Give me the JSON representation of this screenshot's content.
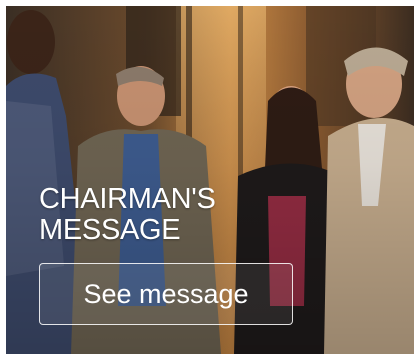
{
  "card": {
    "title_line1": "CHAIRMAN'S",
    "title_line2": "MESSAGE",
    "cta_label": "See message"
  },
  "colors": {
    "text": "#ffffff",
    "button_border": "#ffffff"
  }
}
